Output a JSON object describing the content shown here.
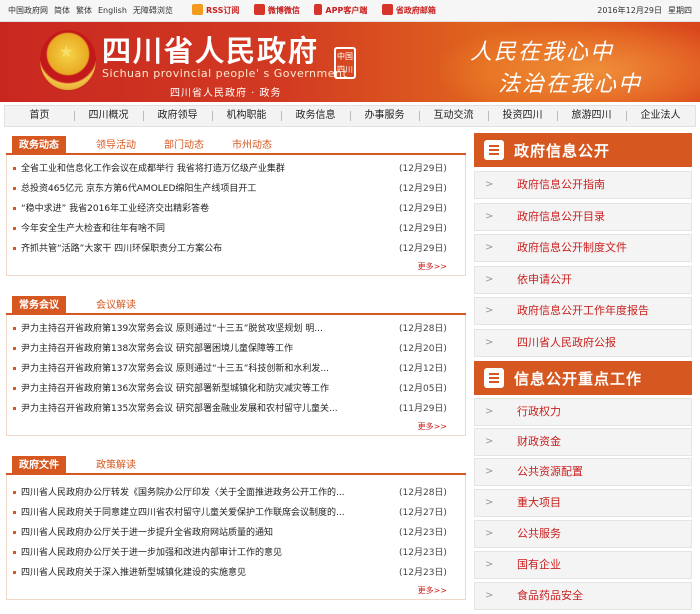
{
  "topbar": {
    "left_links": [
      "中国政府网",
      "简体",
      "繁体",
      "English",
      "无障碍浏览"
    ],
    "mid_links": [
      {
        "label": "RSS订阅",
        "icon": "rss-icon",
        "color": "#f29b1c"
      },
      {
        "label": "微博微信",
        "icon": "weibo-icon",
        "color": "#d7342a"
      },
      {
        "label": "APP客户端",
        "icon": "phone-icon",
        "color": "#d7342a"
      },
      {
        "label": "省政府邮箱",
        "icon": "mail-icon",
        "color": "#d7342a"
      }
    ],
    "date": "2016年12月29日",
    "weekday": "星期四"
  },
  "banner": {
    "title": "四川省人民政府",
    "title_en": "Sichuan provincial people' s Government",
    "subtitle": "四川省人民政府 · 政务",
    "seal": "中国四川",
    "slogan1": "人民在我心中",
    "slogan2": "法治在我心中"
  },
  "nav": [
    "首页",
    "四川概况",
    "政府领导",
    "机构职能",
    "政务信息",
    "办事服务",
    "互动交流",
    "投资四川",
    "旅游四川",
    "企业法人"
  ],
  "sections": [
    {
      "active_tab": "政务动态",
      "tabs": [
        "领导活动",
        "部门动态",
        "市州动态"
      ],
      "items": [
        {
          "title": "全省工业和信息化工作会议在成都举行 我省将打造万亿级产业集群",
          "date": "(12月29日)"
        },
        {
          "title": "总投资465亿元 京东方第6代AMOLED绵阳生产线项目开工",
          "date": "(12月29日)"
        },
        {
          "title": "“稳中求进” 我省2016年工业经济交出精彩答卷",
          "date": "(12月29日)"
        },
        {
          "title": "今年安全生产大检查和往年有啥不同",
          "date": "(12月29日)"
        },
        {
          "title": "齐抓共管“活路”大家干 四川环保职责分工方案公布",
          "date": "(12月29日)"
        }
      ],
      "more": "更多>>"
    },
    {
      "active_tab": "常务会议",
      "tabs": [
        "会议解读"
      ],
      "items": [
        {
          "title": "尹力主持召开省政府第139次常务会议 原则通过“十三五”脱贫攻坚规划 明...",
          "date": "(12月28日)"
        },
        {
          "title": "尹力主持召开省政府第138次常务会议 研究部署困境儿童保障等工作",
          "date": "(12月20日)"
        },
        {
          "title": "尹力主持召开省政府第137次常务会议 原则通过“十三五”科技创新和水利发...",
          "date": "(12月12日)"
        },
        {
          "title": "尹力主持召开省政府第136次常务会议 研究部署新型城镇化和防灾减灾等工作",
          "date": "(12月05日)"
        },
        {
          "title": "尹力主持召开省政府第135次常务会议 研究部署金融业发展和农村留守儿童关...",
          "date": "(11月29日)"
        }
      ],
      "more": "更多>>"
    },
    {
      "active_tab": "政府文件",
      "tabs": [
        "政策解读"
      ],
      "items": [
        {
          "title": "四川省人民政府办公厅转发《国务院办公厅印发〈关于全面推进政务公开工作的...",
          "date": "(12月28日)"
        },
        {
          "title": "四川省人民政府关于同意建立四川省农村留守儿童关爱保护工作联席会议制度的...",
          "date": "(12月27日)"
        },
        {
          "title": "四川省人民政府办公厅关于进一步提升全省政府网站质量的通知",
          "date": "(12月23日)"
        },
        {
          "title": "四川省人民政府办公厅关于进一步加强和改进内部审计工作的意见",
          "date": "(12月23日)"
        },
        {
          "title": "四川省人民政府关于深入推进新型城镇化建设的实施意见",
          "date": "(12月23日)"
        }
      ],
      "more": "更多>>"
    }
  ],
  "right": {
    "panel1": {
      "title": "政府信息公开",
      "items": [
        "政府信息公开指南",
        "政府信息公开目录",
        "政府信息公开制度文件",
        "依申请公开",
        "政府信息公开工作年度报告",
        "四川省人民政府公报"
      ]
    },
    "panel2": {
      "title": "信息公开重点工作",
      "items": [
        "行政权力",
        "财政资金",
        "公共资源配置",
        "重大项目",
        "公共服务",
        "国有企业",
        "食品药品安全"
      ]
    }
  },
  "colors": {
    "accent": "#d6571f",
    "brand_red": "#c8201f"
  }
}
